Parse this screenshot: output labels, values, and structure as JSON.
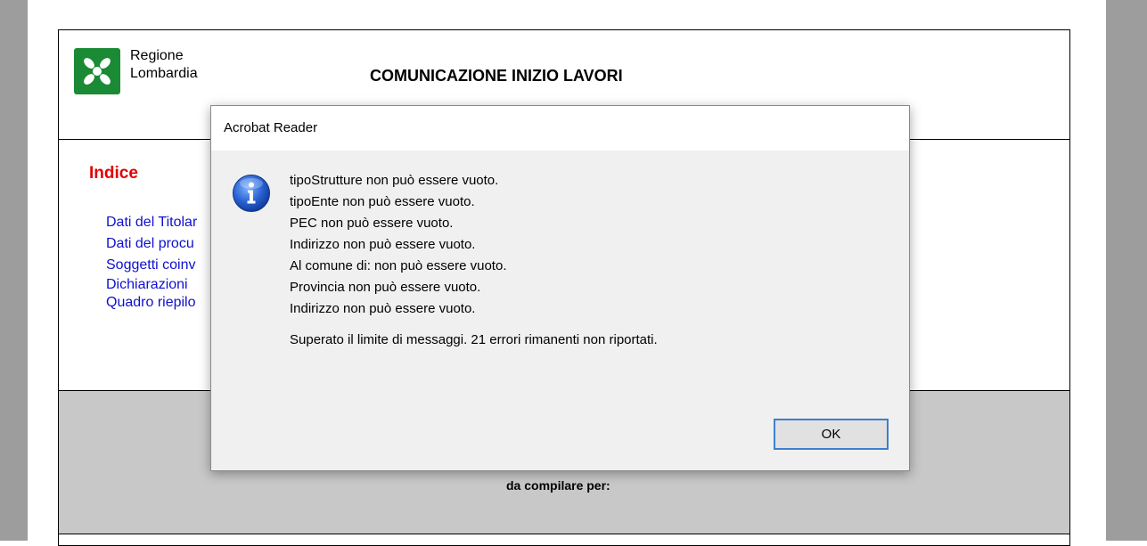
{
  "document": {
    "logo_line1": "Regione",
    "logo_line2": "Lombardia",
    "title": "COMUNICAZIONE INIZIO LAVORI",
    "index_heading": "Indice",
    "index_links": [
      "Dati del Titolar",
      "Dati del procu",
      "Soggetti coinv",
      "Dichiarazioni",
      "Quadro riepilo"
    ],
    "compile_label": "da compilare per:"
  },
  "dialog": {
    "title": "Acrobat Reader",
    "icon": "info-icon",
    "messages": [
      "tipoStrutture non può essere vuoto.",
      "tipoEnte non può essere vuoto.",
      "PEC non può essere vuoto.",
      "Indirizzo non può essere vuoto.",
      "Al comune di: non può essere vuoto.",
      "Provincia non può essere vuoto.",
      "Indirizzo non può essere vuoto."
    ],
    "summary": "Superato il limite di messaggi. 21 errori rimanenti non riportati.",
    "ok_label": "OK"
  },
  "colors": {
    "index_heading": "#e00000",
    "index_links": "#1010d0",
    "logo_green": "#1a8a34",
    "ok_focus_border": "#3c7fce",
    "gray_band": "#c8c8c8"
  }
}
